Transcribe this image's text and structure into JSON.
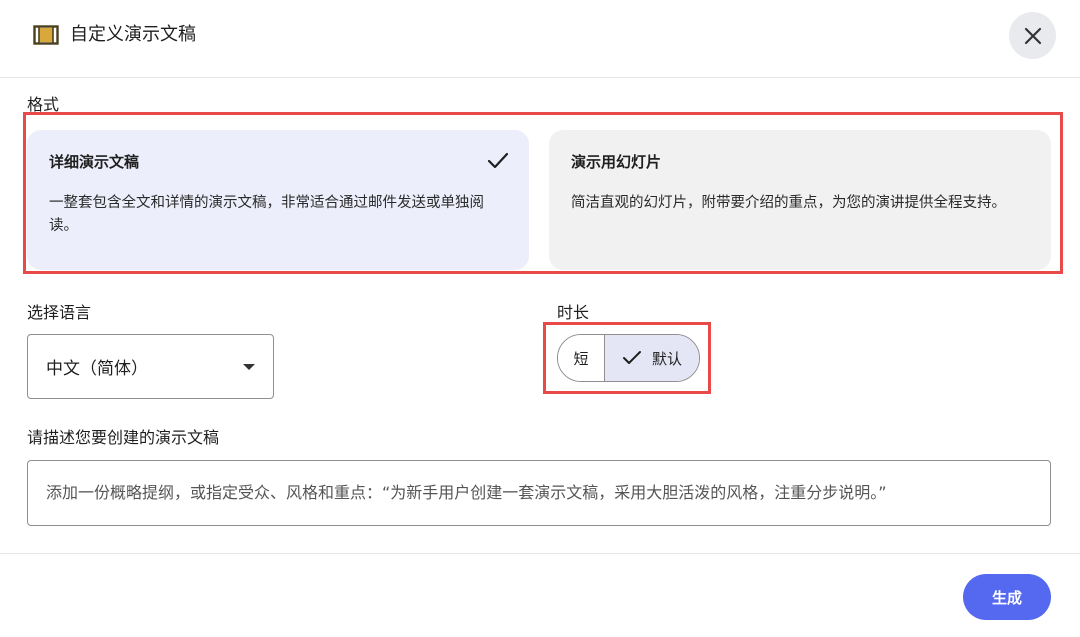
{
  "dialog": {
    "title": "自定义演示文稿",
    "icon": "slides-icon",
    "close_icon": "close-icon"
  },
  "format": {
    "label": "格式",
    "options": [
      {
        "title": "详细演示文稿",
        "description": "一整套包含全文和详情的演示文稿，非常适合通过邮件发送或单独阅读。",
        "selected": true
      },
      {
        "title": "演示用幻灯片",
        "description": "简洁直观的幻灯片，附带要介绍的重点，为您的演讲提供全程支持。",
        "selected": false
      }
    ]
  },
  "language": {
    "label": "选择语言",
    "value": "中文（简体）"
  },
  "duration": {
    "label": "时长",
    "options": [
      {
        "label": "短",
        "selected": false
      },
      {
        "label": "默认",
        "selected": true
      }
    ]
  },
  "description": {
    "label": "请描述您要创建的演示文稿",
    "placeholder": "添加一份概略提纲，或指定受众、风格和重点：“为新手用户创建一套演示文稿，采用大胆活泼的风格，注重分步说明。”"
  },
  "footer": {
    "generate_label": "生成"
  },
  "colors": {
    "accent": "#5468f0",
    "selected_card": "#eceefb",
    "unselected_card": "#f1f1f1",
    "highlight_box": "#e84a4a"
  }
}
